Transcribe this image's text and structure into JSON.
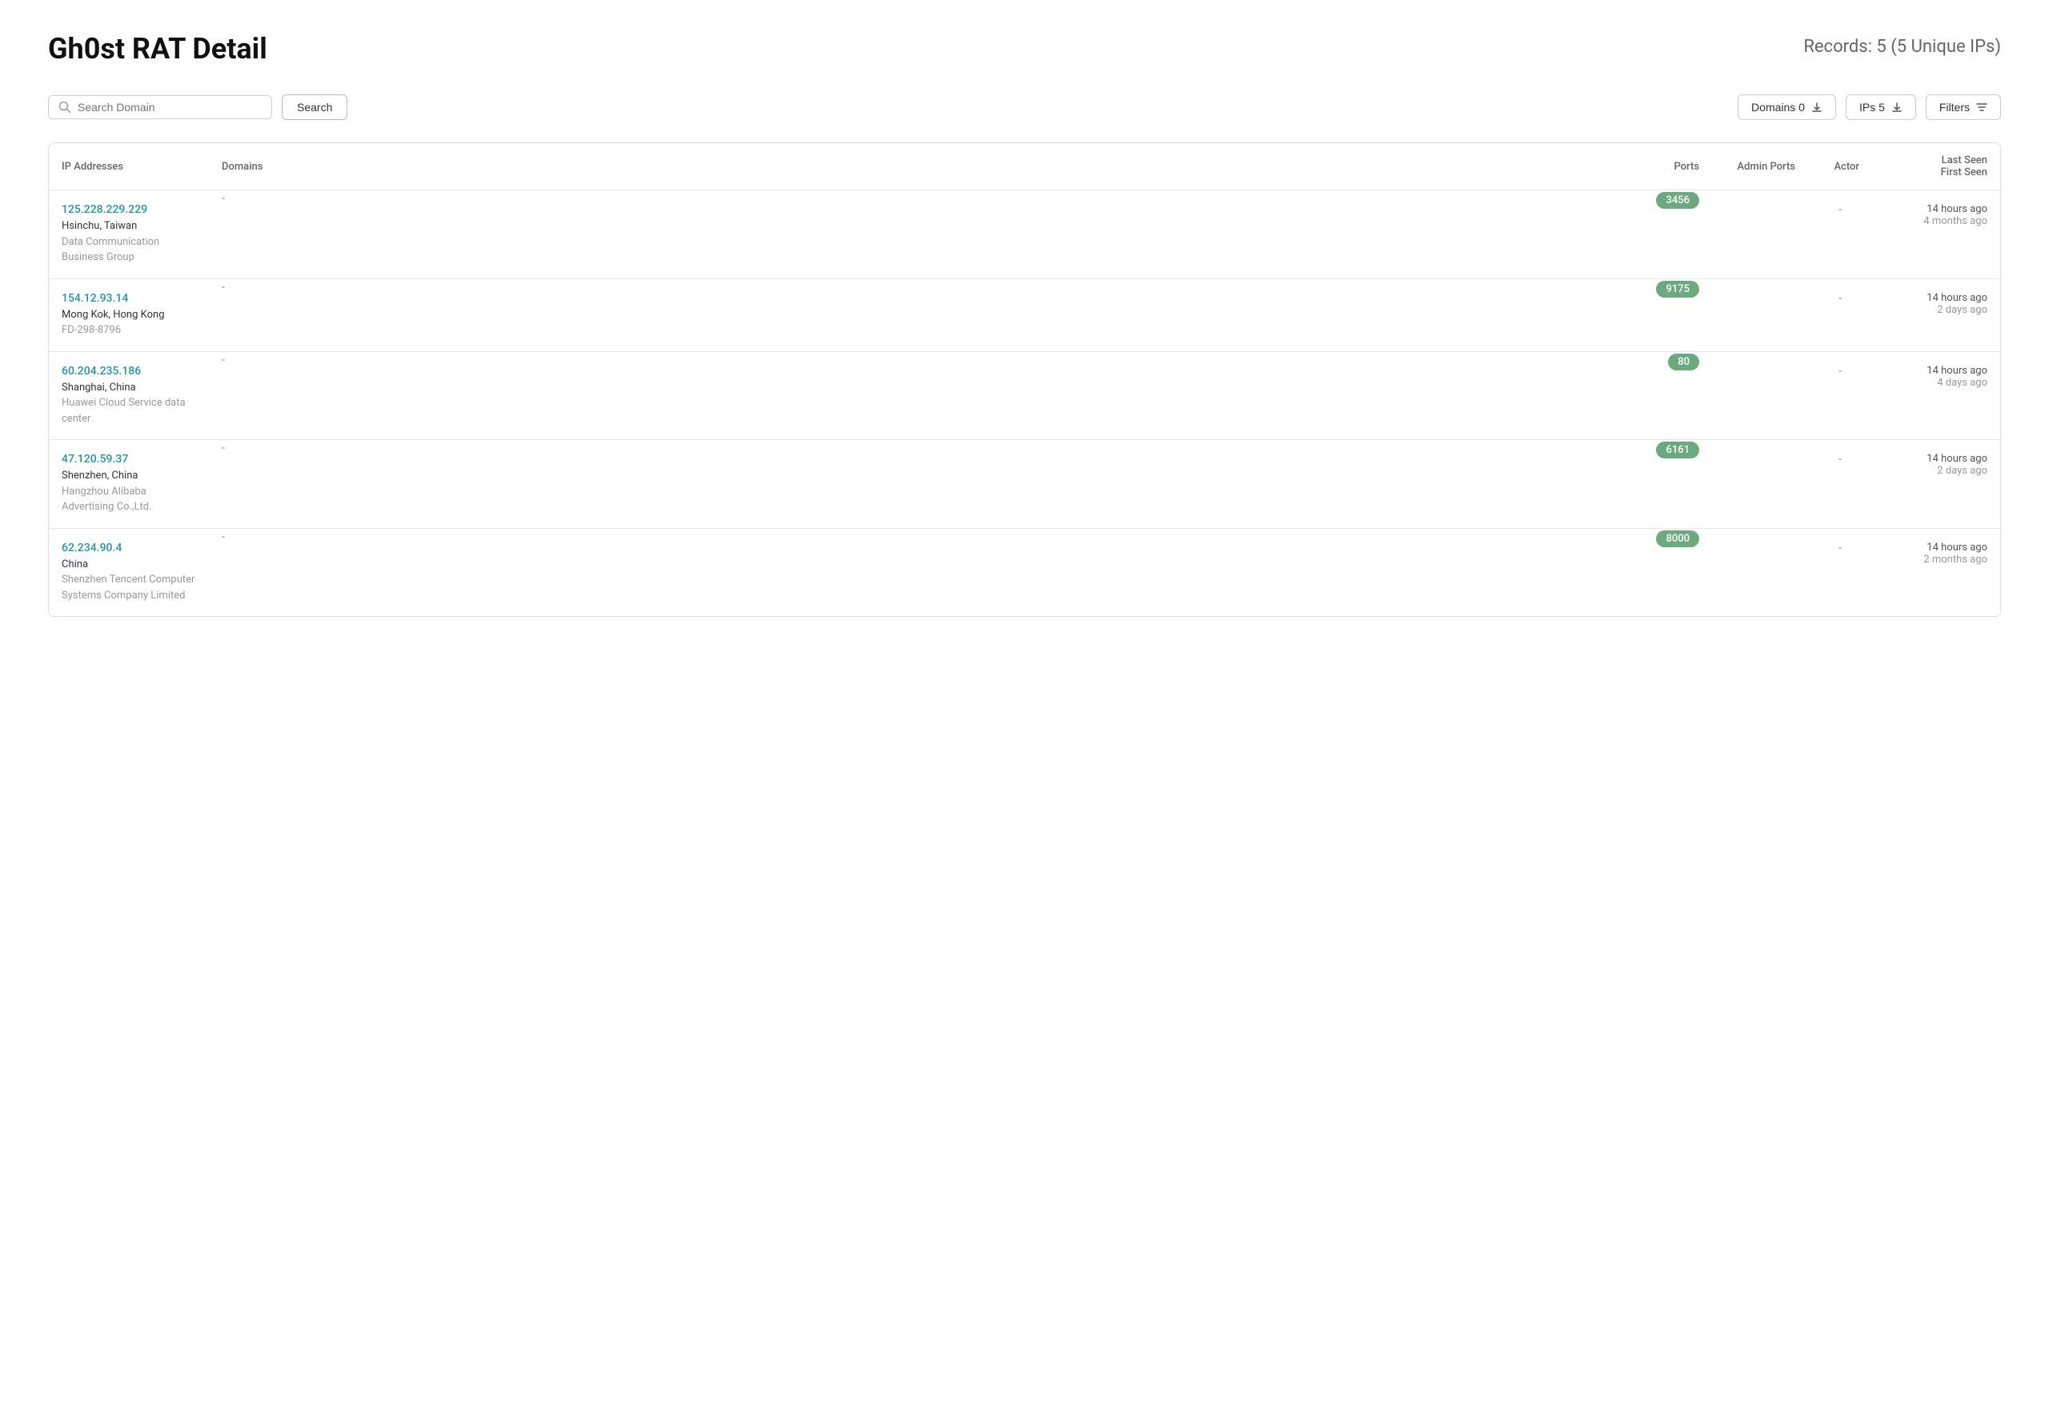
{
  "header": {
    "title": "Gh0st RAT Detail",
    "records_label": "Records: 5",
    "records_sub": "(5 Unique IPs)"
  },
  "toolbar": {
    "search_placeholder": "Search Domain",
    "search_button": "Search",
    "domains_button": "Domains 0",
    "ips_button": "IPs 5",
    "filters_button": "Filters"
  },
  "table": {
    "columns": {
      "ip": "IP Addresses",
      "domains": "Domains",
      "ports": "Ports",
      "admin_ports": "Admin Ports",
      "actor": "Actor",
      "last_seen": "Last Seen",
      "first_seen": "First Seen"
    },
    "rows": [
      {
        "ip": "125.228.229.229",
        "location": "Hsinchu, Taiwan",
        "org": "Data Communication Business Group",
        "domains": "-",
        "port": "3456",
        "admin_ports": "",
        "actor": "-",
        "last_seen": "14 hours ago",
        "first_seen": "4 months ago"
      },
      {
        "ip": "154.12.93.14",
        "location": "Mong Kok, Hong Kong",
        "org": "FD-298-8796",
        "domains": "-",
        "port": "9175",
        "admin_ports": "",
        "actor": "-",
        "last_seen": "14 hours ago",
        "first_seen": "2 days ago"
      },
      {
        "ip": "60.204.235.186",
        "location": "Shanghai, China",
        "org": "Huawei Cloud Service data center",
        "domains": "-",
        "port": "80",
        "admin_ports": "",
        "actor": "-",
        "last_seen": "14 hours ago",
        "first_seen": "4 days ago"
      },
      {
        "ip": "47.120.59.37",
        "location": "Shenzhen, China",
        "org": "Hangzhou Alibaba Advertising Co.,Ltd.",
        "domains": "-",
        "port": "6161",
        "admin_ports": "",
        "actor": "-",
        "last_seen": "14 hours ago",
        "first_seen": "2 days ago"
      },
      {
        "ip": "62.234.90.4",
        "location": "China",
        "org": "Shenzhen Tencent Computer Systems Company Limited",
        "domains": "-",
        "port": "8000",
        "admin_ports": "",
        "actor": "-",
        "last_seen": "14 hours ago",
        "first_seen": "2 months ago"
      }
    ]
  }
}
